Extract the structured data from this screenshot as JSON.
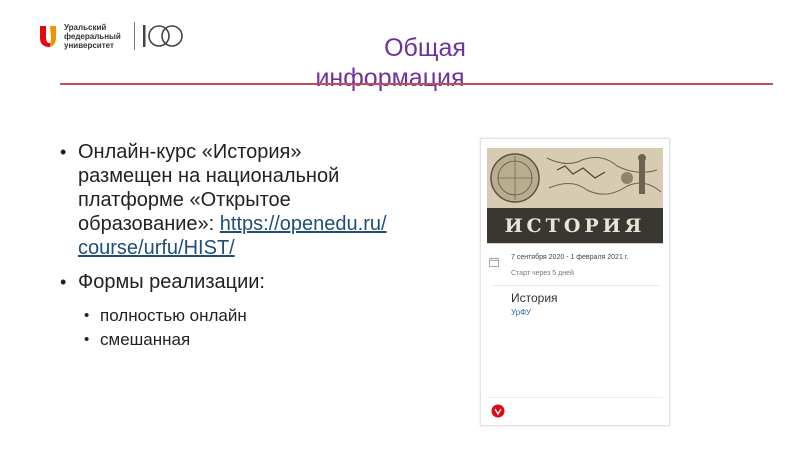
{
  "logo": {
    "line1": "Уральский",
    "line2": "федеральный",
    "line3": "университет"
  },
  "title": {
    "line1": "Общая",
    "line2": "информация"
  },
  "bullets": [
    {
      "text": "Онлайн-курс «История» размещен на национальной платформе «Открытое образование»: ",
      "link": "https://openedu.ru/course/urfu/HIST/"
    },
    {
      "text": "Формы реализации:",
      "sub": [
        "полностью онлайн",
        "смешанная"
      ]
    }
  ],
  "card": {
    "banner": "ИСТОРИЯ",
    "dates": "7 сентября 2020 - 1 февраля 2021 г.",
    "start": "Старт через 5 дней",
    "course": "История",
    "org": "УрФУ"
  },
  "colors": {
    "title": "#7030a0",
    "rule": "#c0504d",
    "link": "#1f4e79",
    "logo_red": "#e30613",
    "logo_orange": "#f39200"
  }
}
